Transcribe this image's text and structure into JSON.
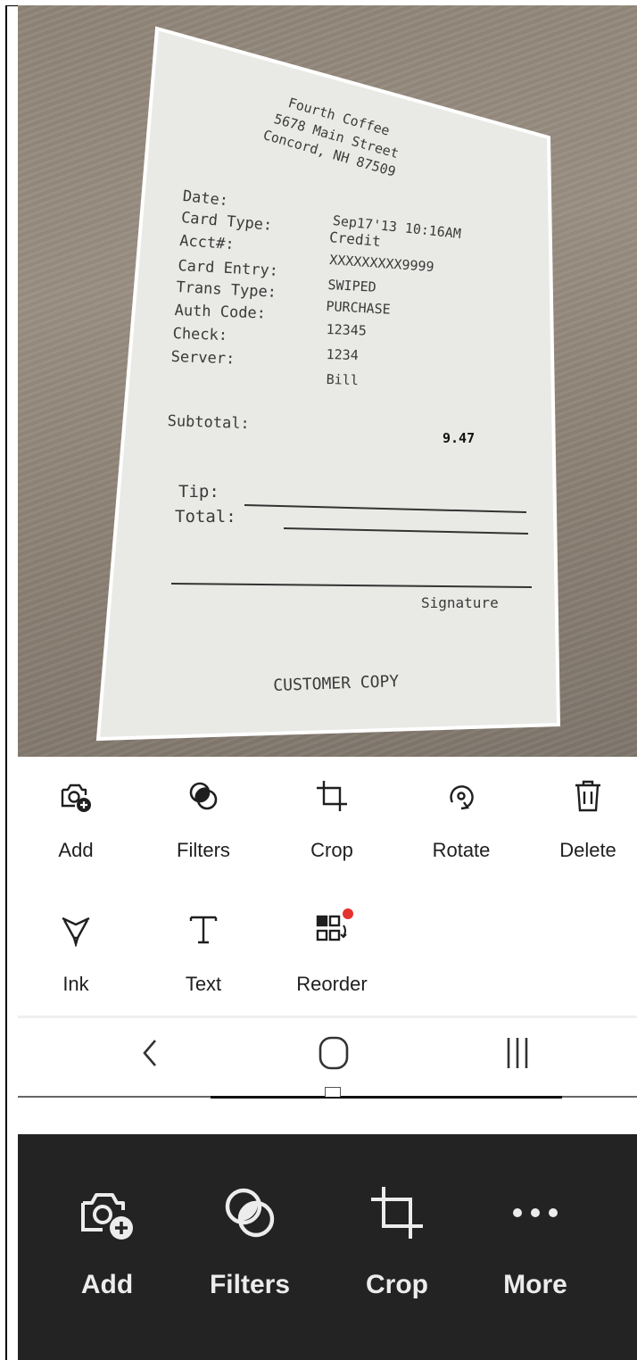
{
  "receipt": {
    "header": [
      "Fourth Coffee",
      "5678 Main Street",
      "Concord, NH 87509"
    ],
    "fields": [
      {
        "label": "Date:",
        "value": "Sep17'13 10:16AM"
      },
      {
        "label": "Card Type:",
        "value": "Credit"
      },
      {
        "label": "Acct#:",
        "value": "XXXXXXXXX9999"
      },
      {
        "label": "Card Entry:",
        "value": "SWIPED"
      },
      {
        "label": "Trans Type:",
        "value": "PURCHASE"
      },
      {
        "label": "Auth Code:",
        "value": "12345"
      },
      {
        "label": "Check:",
        "value": "1234"
      },
      {
        "label": "Server:",
        "value": "Bill"
      }
    ],
    "subtotal_label": "Subtotal:",
    "subtotal_value": "9.47",
    "tip_label": "Tip:",
    "total_label": "Total:",
    "signature_label": "Signature",
    "footer": "CUSTOMER COPY"
  },
  "edit_toolbar": {
    "row1": [
      {
        "label": "Add",
        "icon": "camera-add-icon"
      },
      {
        "label": "Filters",
        "icon": "filters-icon"
      },
      {
        "label": "Crop",
        "icon": "crop-icon"
      },
      {
        "label": "Rotate",
        "icon": "rotate-icon"
      },
      {
        "label": "Delete",
        "icon": "trash-icon"
      }
    ],
    "row2": [
      {
        "label": "Ink",
        "icon": "ink-pen-icon"
      },
      {
        "label": "Text",
        "icon": "text-icon"
      },
      {
        "label": "Reorder",
        "icon": "reorder-icon",
        "badge_color": "#e4322f"
      }
    ]
  },
  "nav_bar": {
    "back": "back-icon",
    "home": "home-icon",
    "recents": "recents-icon"
  },
  "dark_toolbar": [
    {
      "label": "Add",
      "icon": "camera-add-icon"
    },
    {
      "label": "Filters",
      "icon": "filters-icon"
    },
    {
      "label": "Crop",
      "icon": "crop-icon"
    },
    {
      "label": "More",
      "icon": "more-icon"
    }
  ],
  "colors": {
    "dark_toolbar_bg": "#232323",
    "badge": "#e4322f",
    "detected_edge": "#ffffff"
  }
}
